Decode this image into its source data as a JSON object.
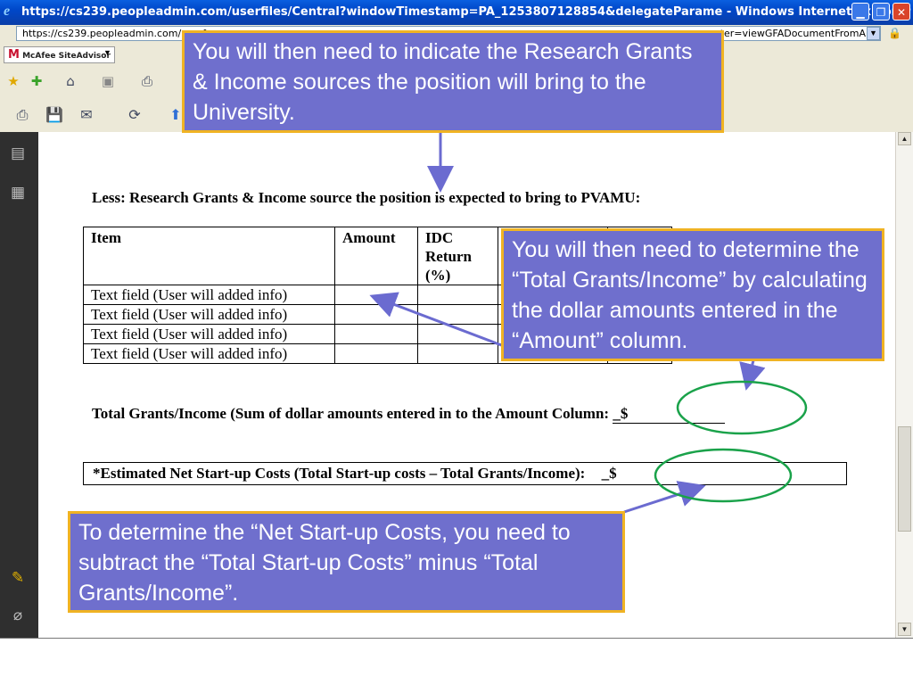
{
  "browser": {
    "title": "https://cs239.peopleadmin.com/userfiles/Central?windowTimestamp=PA_1253807128854&delegateParame - Windows Internet Explorer",
    "address_left": "https://cs239.peopleadmin.com/userf",
    "address_right": "ameter=viewGFADocumentFromA",
    "toolbar_logo": "McAfee SiteAdvisor",
    "toolbar_logo_mark": "M",
    "icons": [
      "ie-logo-icon",
      "minimize-icon",
      "restore-icon",
      "close-icon",
      "dropdown-icon",
      "lock-icon",
      "favorites-star-icon",
      "add-favorites-icon",
      "home-icon",
      "feeds-icon",
      "print-icon",
      "save-icon",
      "print-tool-icon",
      "email-icon",
      "pages-icon",
      "bookmarks-icon",
      "comments-icon",
      "attachments-icon"
    ]
  },
  "document": {
    "heading": "Less: Research Grants & Income source the position is expected to bring to PVAMU:",
    "table": {
      "columns": [
        "Item",
        "Amount",
        "IDC Return (%)",
        "",
        ""
      ],
      "rows": [
        [
          "Text field  (User will added info)",
          "",
          "",
          "",
          ""
        ],
        [
          "Text field  (User will added info)",
          "",
          "",
          "",
          ""
        ],
        [
          "Text field  (User will added info)",
          "",
          "",
          "",
          ""
        ],
        [
          "Text field  (User will added info)",
          "",
          "",
          "",
          ""
        ]
      ]
    },
    "total_label": "Total Grants/Income (Sum of dollar amounts entered in to the  Amount Column:",
    "total_prefix": "_$",
    "net_label": "*Estimated Net Start-up Costs (Total Start-up costs – Total Grants/Income):",
    "net_prefix": "_$"
  },
  "callouts": {
    "top": "You will then need to indicate the Research Grants & Income sources  the position will bring to the University.",
    "right": "You will then need to determine the “Total Grants/Income” by calculating the dollar amounts entered in the “Amount” column.",
    "bottom": "To determine the “Net Start-up Costs, you need to subtract the “Total Start-up Costs” minus “Total Grants/Income”."
  },
  "colors": {
    "callout_fill": "#6f6fcd",
    "callout_border": "#f0b323",
    "arrow": "#6b6bd0",
    "ellipse": "#1aa24a"
  }
}
